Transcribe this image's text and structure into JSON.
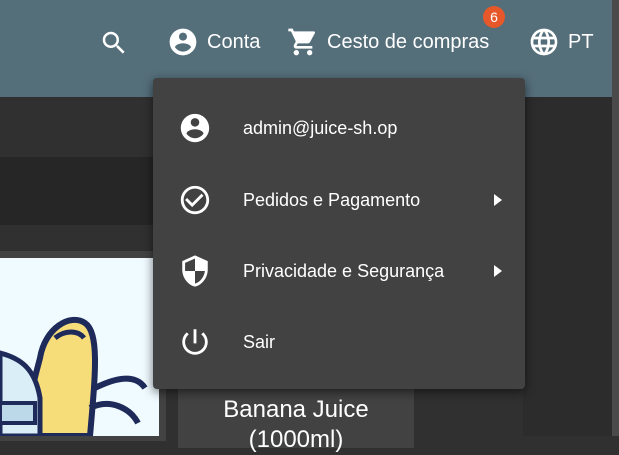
{
  "toolbar": {
    "account_label": "Conta",
    "basket_label": "Cesto de compras",
    "basket_count": "6",
    "language_label": "PT"
  },
  "menu": {
    "items": [
      {
        "label": "admin@juice-sh.op",
        "icon": "account-circle-icon",
        "has_submenu": false
      },
      {
        "label": "Pedidos e Pagamento",
        "icon": "check-circle-icon",
        "has_submenu": true
      },
      {
        "label": "Privacidade e Segurança",
        "icon": "shield-icon",
        "has_submenu": true
      },
      {
        "label": "Sair",
        "icon": "power-icon",
        "has_submenu": false
      }
    ]
  },
  "product": {
    "title": "Banana Juice (1000ml)"
  },
  "colors": {
    "toolbar": "#546e7a",
    "badge": "#e6582a",
    "menu": "#424242",
    "background": "#303030"
  }
}
